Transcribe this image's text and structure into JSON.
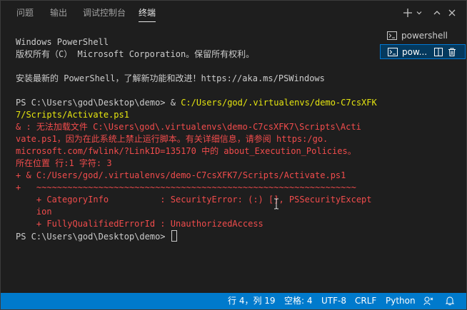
{
  "panel": {
    "tabs": [
      {
        "label": "问题"
      },
      {
        "label": "输出"
      },
      {
        "label": "调试控制台"
      },
      {
        "label": "终端"
      }
    ],
    "active_tab": "终端",
    "actions": {
      "new_terminal": "+",
      "dropdown": "⌄",
      "maximize": "∧",
      "close": "✕"
    }
  },
  "terminal": {
    "lines": [
      {
        "segments": [
          {
            "text": "Windows PowerShell",
            "color": "default"
          }
        ]
      },
      {
        "segments": [
          {
            "text": "版权所有（C） Microsoft Corporation。保留所有权利。",
            "color": "default"
          }
        ]
      },
      {
        "segments": [
          {
            "text": "",
            "color": "default"
          }
        ]
      },
      {
        "segments": [
          {
            "text": "安装最新的 PowerShell，了解新功能和改进！https://aka.ms/PSWindows",
            "color": "default"
          }
        ]
      },
      {
        "segments": [
          {
            "text": "",
            "color": "default"
          }
        ]
      },
      {
        "segments": [
          {
            "text": "PS C:\\Users\\god\\Desktop\\demo> & ",
            "color": "default"
          },
          {
            "text": "C:/Users/god/.virtualenvs/demo-C7csXFK",
            "color": "yellow"
          }
        ]
      },
      {
        "segments": [
          {
            "text": "7/Scripts/Activate.ps1",
            "color": "yellow"
          }
        ]
      },
      {
        "segments": [
          {
            "text": "& : 无法加载文件 C:\\Users\\god\\.virtualenvs\\demo-C7csXFK7\\Scripts\\Acti",
            "color": "red"
          }
        ]
      },
      {
        "segments": [
          {
            "text": "vate.ps1，因为在此系统上禁止运行脚本。有关详细信息，请参阅 https:/go.",
            "color": "red"
          }
        ]
      },
      {
        "segments": [
          {
            "text": "microsoft.com/fwlink/?LinkID=135170 中的 about_Execution_Policies。",
            "color": "red"
          }
        ]
      },
      {
        "segments": [
          {
            "text": "所在位置 行:1 字符: 3",
            "color": "red"
          }
        ]
      },
      {
        "segments": [
          {
            "text": "+ & C:/Users/god/.virtualenvs/demo-C7csXFK7/Scripts/Activate.ps1",
            "color": "red"
          }
        ]
      },
      {
        "segments": [
          {
            "text": "+   ~~~~~~~~~~~~~~~~~~~~~~~~~~~~~~~~~~~~~~~~~~~~~~~~~~~~~~~~~~~~~~",
            "color": "red"
          }
        ]
      },
      {
        "segments": [
          {
            "text": "    + CategoryInfo          : SecurityError: (:) [], PSSecurityExcept",
            "color": "red"
          }
        ]
      },
      {
        "segments": [
          {
            "text": "    ion",
            "color": "red"
          }
        ]
      },
      {
        "segments": [
          {
            "text": "    + FullyQualifiedErrorId : UnauthorizedAccess",
            "color": "red"
          }
        ]
      },
      {
        "segments": [
          {
            "text": "PS C:\\Users\\god\\Desktop\\demo> ",
            "color": "default"
          }
        ],
        "cursor": true
      }
    ]
  },
  "terminal_list": {
    "items": [
      {
        "label": "powershell",
        "selected": false
      },
      {
        "label": "pow...",
        "selected": true
      }
    ]
  },
  "status_bar": {
    "position": "行 4，列 19",
    "spaces": "空格: 4",
    "encoding": "UTF-8",
    "eol": "CRLF",
    "language": "Python"
  },
  "colors": {
    "background": "#1e1e1e",
    "status_bar": "#007acc",
    "yellow": "#e5e510",
    "red": "#f14c4c",
    "selection": "#04395e"
  }
}
